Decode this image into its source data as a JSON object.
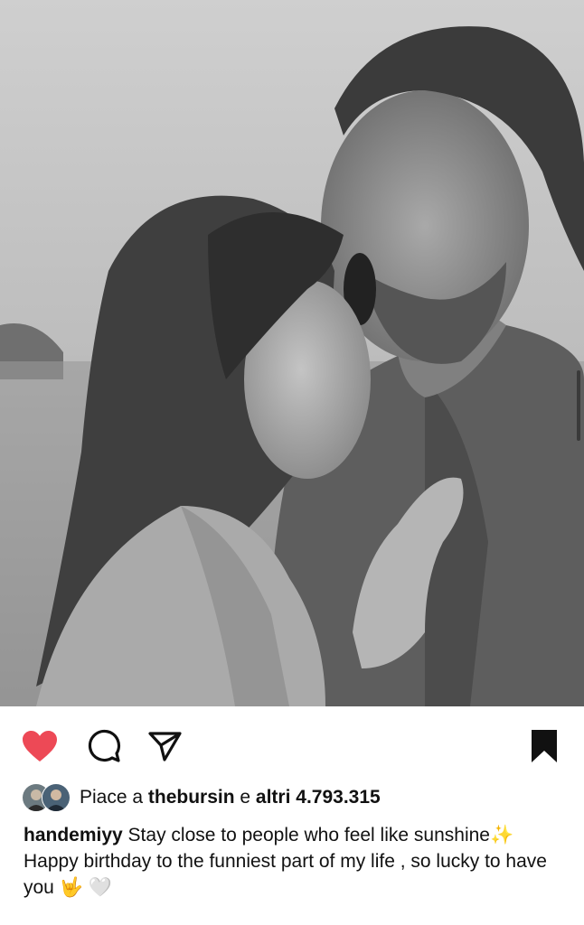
{
  "post": {
    "image_alt": "Black and white photo of a couple embracing by the sea",
    "icons": {
      "like": "heart-filled-icon",
      "comment": "comment-bubble-icon",
      "share": "paper-plane-icon",
      "save": "bookmark-filled-icon"
    },
    "colors": {
      "like_active": "#ed4956",
      "icon": "#111111",
      "text": "#111111"
    }
  },
  "likes": {
    "prefix": "Piace a ",
    "user": "thebursin",
    "middle": " e ",
    "others": "altri 4.793.315"
  },
  "caption": {
    "username": "handemiyy",
    "line1": " Stay close to people who feel like sunshine",
    "sparkle_emoji": "✨",
    "line2": "Happy birthday to the funniest part of my life , so lucky to have you ",
    "hand_emoji": "🤟",
    "heart_emoji": "🤍"
  }
}
